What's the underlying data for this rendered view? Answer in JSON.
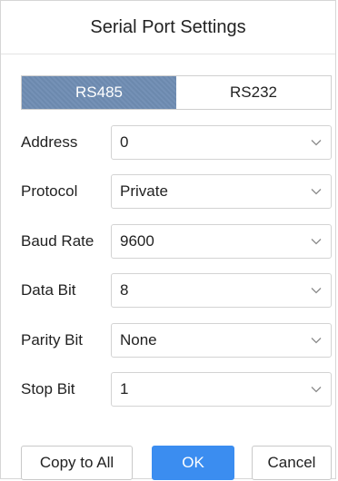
{
  "dialog": {
    "title": "Serial Port Settings"
  },
  "tabs": [
    {
      "label": "RS485",
      "active": true
    },
    {
      "label": "RS232",
      "active": false
    }
  ],
  "fields": {
    "address": {
      "label": "Address",
      "value": "0"
    },
    "protocol": {
      "label": "Protocol",
      "value": "Private"
    },
    "baud_rate": {
      "label": "Baud Rate",
      "value": "9600"
    },
    "data_bit": {
      "label": "Data Bit",
      "value": "8"
    },
    "parity_bit": {
      "label": "Parity Bit",
      "value": "None"
    },
    "stop_bit": {
      "label": "Stop Bit",
      "value": "1"
    }
  },
  "buttons": {
    "copy_to_all": "Copy to All",
    "ok": "OK",
    "cancel": "Cancel"
  },
  "colors": {
    "active_tab": "#6f8db3",
    "primary_button": "#3b8df0"
  },
  "icons": {
    "dropdown": "chevron-down-icon"
  }
}
